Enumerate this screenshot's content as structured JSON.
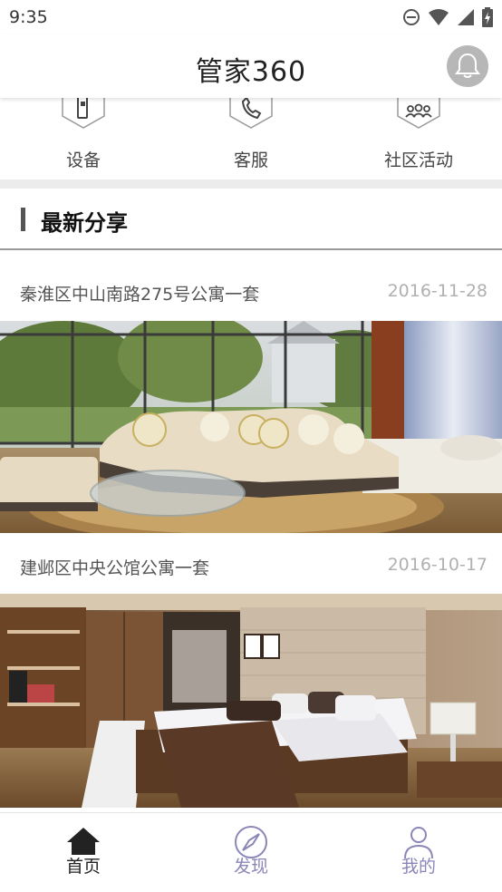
{
  "status_bar": {
    "time": "9:35"
  },
  "header": {
    "title": "管家360"
  },
  "quick_menu": [
    {
      "label": "设备",
      "icon": "device-icon"
    },
    {
      "label": "客服",
      "icon": "phone-icon"
    },
    {
      "label": "社区活动",
      "icon": "community-icon"
    }
  ],
  "section": {
    "title": "最新分享"
  },
  "shares": [
    {
      "title": "秦淮区中山南路275号公寓一套",
      "date": "2016-11-28",
      "image": "living-room-photo"
    },
    {
      "title": "建邺区中央公馆公寓一套",
      "date": "2016-10-17",
      "image": "bedroom-photo"
    }
  ],
  "bottom_nav": [
    {
      "label": "首页",
      "icon": "home-icon",
      "active": true
    },
    {
      "label": "发现",
      "icon": "compass-icon",
      "active": false
    },
    {
      "label": "我的",
      "icon": "user-icon",
      "active": false
    }
  ],
  "colors": {
    "nav_active": "#222222",
    "nav_inactive": "#8a86b8",
    "bell_bg": "#b7b7b7",
    "divider": "#ececec"
  }
}
